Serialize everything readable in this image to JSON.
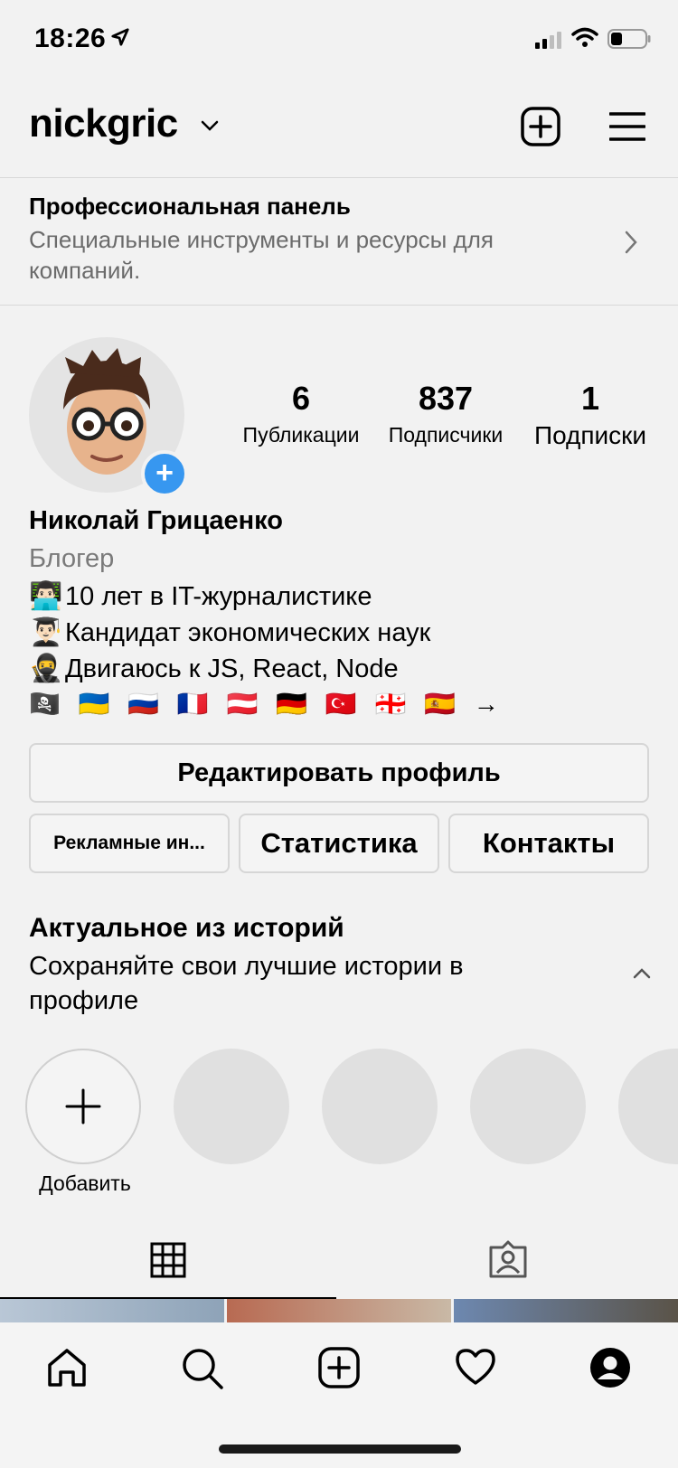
{
  "status_bar": {
    "time": "18:26"
  },
  "header": {
    "username": "nickgric"
  },
  "pro_panel": {
    "title": "Профессиональная панель",
    "subtitle": "Специальные инструменты и ресурсы для компаний."
  },
  "profile": {
    "stats": [
      {
        "value": "6",
        "label": "Публикации"
      },
      {
        "value": "837",
        "label": "Подписчики"
      },
      {
        "value": "1",
        "label": "Подписки"
      }
    ],
    "name": "Николай Грицаенко",
    "category": "Блогер",
    "bio_lines": [
      {
        "emoji": "👨🏻‍💻",
        "text": "10 лет в IT-журналистике"
      },
      {
        "emoji": "👨🏻‍🎓",
        "text": "Кандидат экономических наук"
      },
      {
        "emoji": "🥷",
        "text": "Двигаюсь к JS, React, Node"
      }
    ],
    "flags": "🏴‍☠️ 🇺🇦 🇷🇺 🇫🇷 🇦🇹 🇩🇪 🇹🇷 🇬🇪 🇪🇸 →"
  },
  "buttons": {
    "edit_profile": "Редактировать профиль",
    "ads": "Рекламные ин...",
    "stats": "Статистика",
    "contacts": "Контакты"
  },
  "highlights": {
    "title": "Актуальное из историй",
    "subtitle": "Сохраняйте свои лучшие истории в профиле",
    "add_label": "Добавить"
  },
  "colors": {
    "accent": "#3797f0",
    "background": "#f2f2f2",
    "placeholder": "#e0e0e0"
  },
  "icons": {
    "status": [
      "location-arrow-icon",
      "signal-icon",
      "wifi-icon",
      "battery-icon"
    ],
    "header": [
      "chevron-down-icon",
      "new-post-icon",
      "menu-icon"
    ],
    "tabs": [
      "grid-icon",
      "tagged-icon"
    ],
    "nav": [
      "home-icon",
      "search-icon",
      "new-post-icon",
      "heart-icon",
      "profile-icon"
    ]
  }
}
